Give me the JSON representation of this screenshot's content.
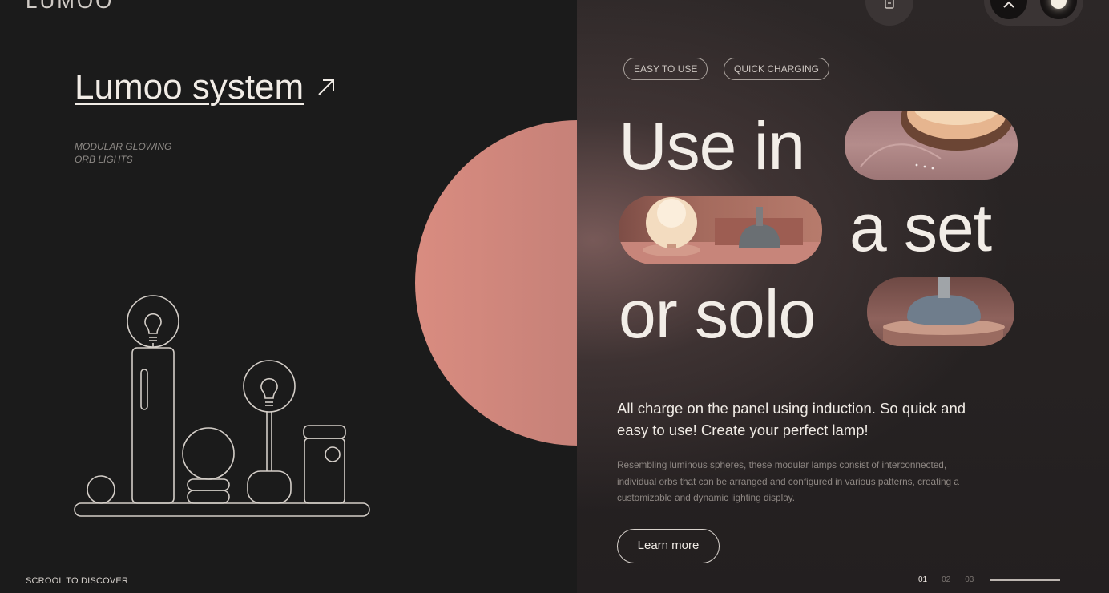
{
  "brand": "LUMOO",
  "left": {
    "title": "Lumoo system",
    "subtitle_line1": "MODULAR GLOWING",
    "subtitle_line2": "ORB LIGHTS",
    "scroll_hint": "SCROOL TO DISCOVER"
  },
  "tags": [
    "EASY TO USE",
    "QUICK CHARGING"
  ],
  "headline": {
    "word1": "Use in",
    "word2": "a set",
    "word3": "or solo"
  },
  "lead": "All charge on the panel using induction. So quick and easy to use! Create your perfect lamp!",
  "body": "Resembling luminous spheres, these modular lamps consist of interconnected, individual orbs that can be arranged and configured in various patterns, creating a customizable and dynamic lighting display.",
  "cta": "Learn more",
  "pager": [
    "01",
    "02",
    "03"
  ],
  "colors": {
    "orb": "#c88279",
    "background": "#1b1b1b",
    "panel": "#262222",
    "text": "#f2ede7"
  },
  "icons": {
    "title": "arrow-up-right-icon",
    "doc": "document-icon",
    "toggle_left": "chevron-up-icon",
    "toggle_right": "light-dot-icon"
  }
}
